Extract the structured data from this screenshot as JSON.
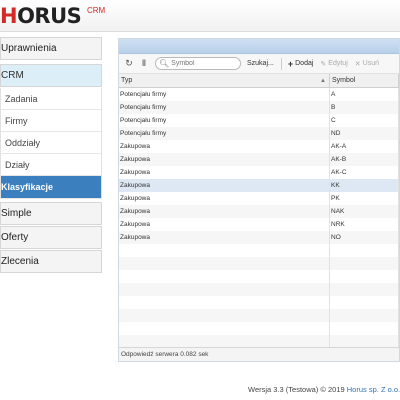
{
  "header": {
    "logo_prefix": "H",
    "logo_main": "ORUS",
    "logo_sup": "CRM"
  },
  "sidebar": {
    "items": [
      {
        "label": "Uprawnienia"
      },
      {
        "label": "CRM"
      },
      {
        "label": "Zadania"
      },
      {
        "label": "Firmy"
      },
      {
        "label": "Oddziały"
      },
      {
        "label": "Działy"
      },
      {
        "label": "Klasyfikacje"
      },
      {
        "label": "Simple"
      },
      {
        "label": "Oferty"
      },
      {
        "label": "Zlecenia"
      }
    ]
  },
  "toolbar": {
    "search_placeholder": "Symbol",
    "search_button": "Szukaj...",
    "add_label": "Dodaj",
    "edit_label": "Edytuj",
    "delete_label": "Usuń"
  },
  "grid": {
    "columns": [
      "Typ",
      "Symbol"
    ],
    "rows": [
      {
        "typ": "Potencjału firmy",
        "symbol": "A"
      },
      {
        "typ": "Potencjału firmy",
        "symbol": "B"
      },
      {
        "typ": "Potencjału firmy",
        "symbol": "C"
      },
      {
        "typ": "Potencjału firmy",
        "symbol": "ND"
      },
      {
        "typ": "Zakupowa",
        "symbol": "AK-A"
      },
      {
        "typ": "Zakupowa",
        "symbol": "AK-B"
      },
      {
        "typ": "Zakupowa",
        "symbol": "AK-C"
      },
      {
        "typ": "Zakupowa",
        "symbol": "KK"
      },
      {
        "typ": "Zakupowa",
        "symbol": "PK"
      },
      {
        "typ": "Zakupowa",
        "symbol": "NAK"
      },
      {
        "typ": "Zakupowa",
        "symbol": "NRK"
      },
      {
        "typ": "Zakupowa",
        "symbol": "NO"
      }
    ],
    "status": "Odpowiedź serwera 0.082 sek"
  },
  "footer": {
    "version": "Wersja 3.3 (Testowa) © 2019 ",
    "company": "Horus sp. Z o.o."
  }
}
